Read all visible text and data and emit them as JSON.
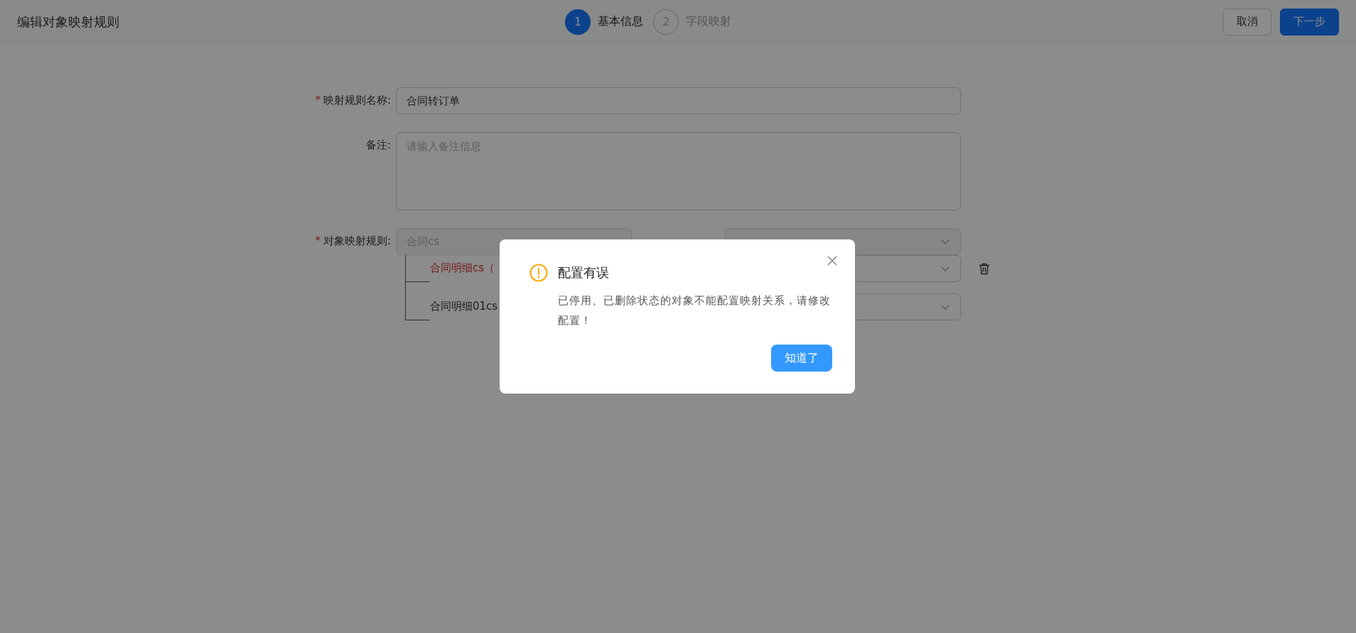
{
  "header": {
    "title": "编辑对象映射规则",
    "steps": [
      {
        "number": "1",
        "label": "基本信息",
        "selected": true
      },
      {
        "number": "2",
        "label": "字段映射",
        "selected": false
      }
    ],
    "buttons": [
      {
        "label": "取消",
        "kind": "default"
      },
      {
        "label": "下一步",
        "kind": "primary"
      }
    ]
  },
  "form": {
    "name": {
      "mark": "*",
      "label": "映射规则名称:",
      "value": "合同转订单"
    },
    "remark": {
      "label": "备注:",
      "placeholder": "请输入备注信息"
    },
    "mapping": {
      "mark": "*",
      "label": "对象映射规则:",
      "source": "合同cs",
      "children": [
        {
          "label": "合同明细cs（",
          "error": true,
          "deletable": true
        },
        {
          "label": "合同明细01cs",
          "error": false,
          "deletable": false
        }
      ]
    }
  },
  "dialog": {
    "title": "配置有误",
    "message": "已停用、已删除状态的对象不能配置映射关系，请修改配置！",
    "button": "知道了"
  }
}
